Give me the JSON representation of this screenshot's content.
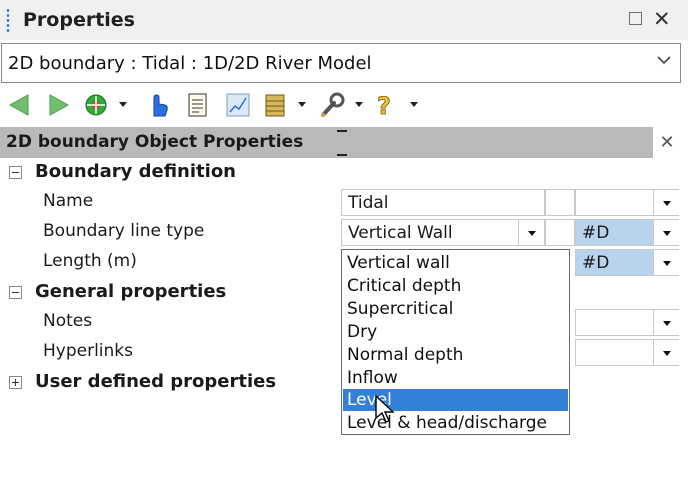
{
  "panel": {
    "title": "Properties"
  },
  "object_selector": {
    "value": "2D boundary : Tidal : 1D/2D River Model"
  },
  "toolbar": {
    "icons": [
      "back-arrow-icon",
      "forward-arrow-icon",
      "action-icon",
      "pointer-hand-icon",
      "document-icon",
      "chart-icon",
      "database-icon",
      "wrench-icon",
      "help-icon"
    ]
  },
  "section": {
    "title": "2D boundary Object Properties"
  },
  "groups": {
    "boundary_definition": "Boundary definition",
    "general_properties": "General properties",
    "user_defined": "User defined properties"
  },
  "properties": {
    "name": {
      "label": "Name",
      "value": "Tidal"
    },
    "boundary_line_type": {
      "label": "Boundary line type",
      "value": "Vertical Wall",
      "flag": "#D"
    },
    "length": {
      "label": "Length (m)",
      "flag": "#D"
    },
    "notes": {
      "label": "Notes"
    },
    "hyperlinks": {
      "label": "Hyperlinks"
    }
  },
  "dropdown": {
    "options": [
      "Vertical wall",
      "Critical depth",
      "Supercritical",
      "Dry",
      "Normal depth",
      "Inflow",
      "Level",
      "Level & head/discharge"
    ],
    "highlighted": "Level"
  },
  "colors": {
    "highlight": "#3380d8",
    "flag_cell": "#b8d3ee",
    "section_header": "#b9b9b9"
  }
}
